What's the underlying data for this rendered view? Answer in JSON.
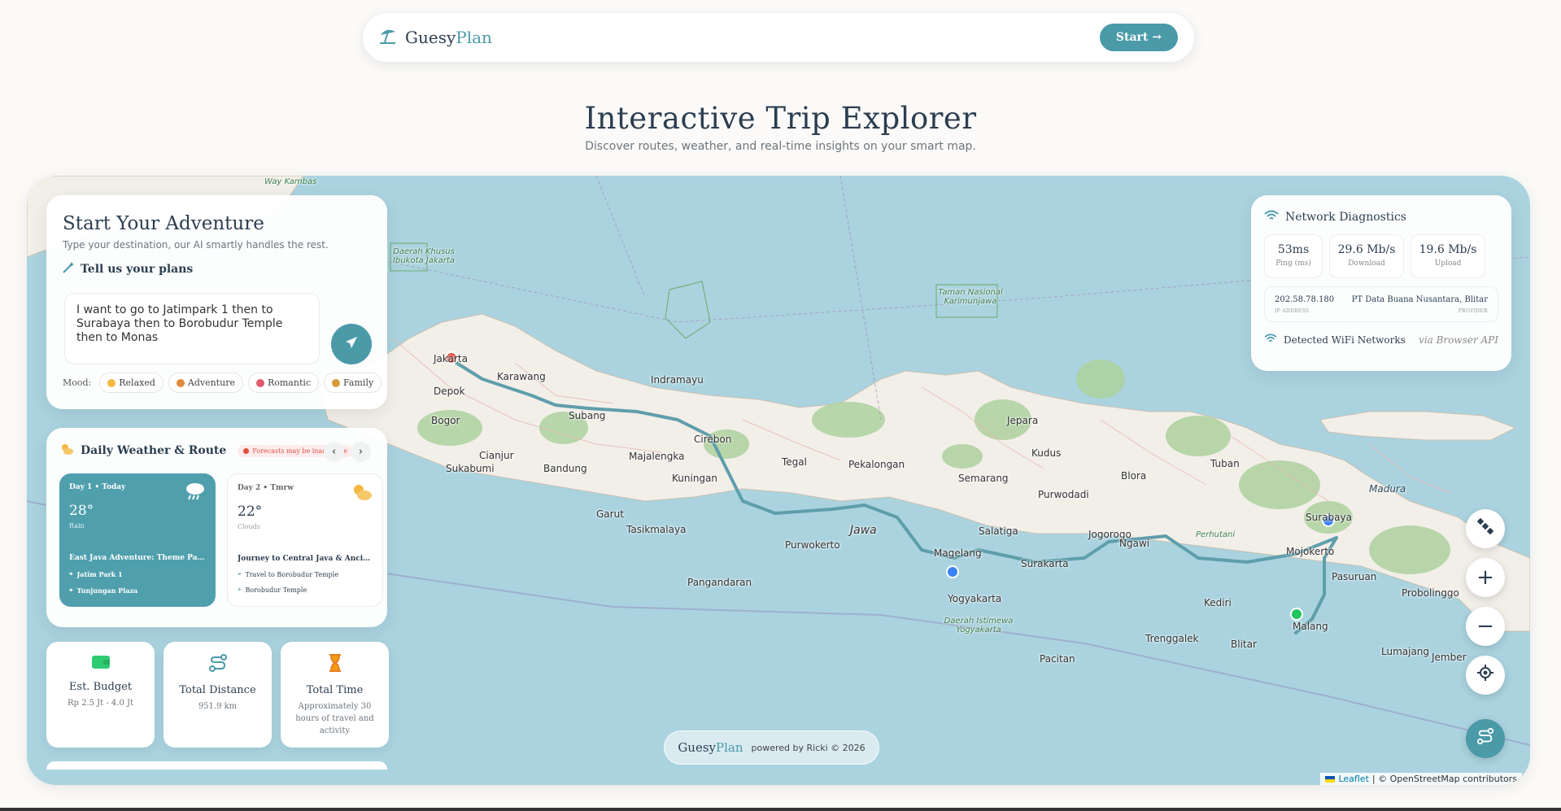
{
  "nav": {
    "brand_prefix": "Guesy",
    "brand_suffix": "Plan",
    "start_label": "Start →"
  },
  "hero": {
    "title": "Interactive Trip Explorer",
    "subtitle": "Discover routes, weather, and real-time insights on your smart map."
  },
  "adventure": {
    "title": "Start Your Adventure",
    "subtitle": "Type your destination, our AI smartly handles the rest.",
    "plans_label": "Tell us your plans",
    "plans_text": "I want to go to Jatimpark 1 then to Surabaya then to Borobudur Temple then to Monas",
    "mood_label": "Mood:",
    "moods": [
      "Relaxed",
      "Adventure",
      "Romantic",
      "Family"
    ]
  },
  "weather": {
    "title": "Daily Weather & Route",
    "warning": "Forecasts may be inaccurate",
    "prev": "‹",
    "next": "›",
    "days": [
      {
        "label": "Day 1 • Today",
        "temp": "28°",
        "condition": "Rain",
        "trip": "East Java Adventure: Theme Park ...",
        "stops": [
          "Jatim Park 1",
          "Tunjungan Plaza"
        ]
      },
      {
        "label": "Day 2 • Tmrw",
        "temp": "22°",
        "condition": "Clouds",
        "trip": "Journey to Central Java & Ancient ...",
        "stops": [
          "Travel to Borobudur Temple",
          "Borobudur Temple"
        ]
      }
    ]
  },
  "stats": {
    "budget": {
      "title": "Est. Budget",
      "value": "Rp 2.5 Jt - 4.0 Jt"
    },
    "distance": {
      "title": "Total Distance",
      "value": "951.9 km"
    },
    "time": {
      "title": "Total Time",
      "value": "Approximately 30 hours of travel and activity"
    }
  },
  "network": {
    "title": "Network Diagnostics",
    "ping": {
      "value": "53ms",
      "caption": "Ping (ms)"
    },
    "download": {
      "value": "29.6 Mb/s",
      "caption": "Download"
    },
    "upload": {
      "value": "19.6 Mb/s",
      "caption": "Upload"
    },
    "ip": {
      "value": "202.58.78.180",
      "caption": "IP ADDRESS"
    },
    "provider": {
      "value": "PT Data Buana Nusantara, Blitar",
      "caption": "PROVIDER"
    },
    "wifi_label": "Detected WiFi Networks",
    "wifi_via": "via Browser API"
  },
  "map": {
    "labels": {
      "jakarta": "Jakarta",
      "depok": "Depok",
      "bogor": "Bogor",
      "karawang": "Karawang",
      "subang": "Subang",
      "indramayu": "Indramayu",
      "cirebon": "Cirebon",
      "majalengka": "Majalengka",
      "kuningan": "Kuningan",
      "cianjur": "Cianjur",
      "bandung": "Bandung",
      "sukabumi": "Sukabumi",
      "garut": "Garut",
      "tasikmalaya": "Tasikmalaya",
      "pangandaran": "Pangandaran",
      "purwokerto": "Purwokerto",
      "jawa": "Jawa",
      "tegal": "Tegal",
      "pekalongan": "Pekalongan",
      "semarang": "Semarang",
      "jepara": "Jepara",
      "kudus": "Kudus",
      "purwodadi": "Purwodadi",
      "blora": "Blora",
      "tuban": "Tuban",
      "madura": "Madura",
      "surabaya": "Surabaya",
      "magelang": "Magelang",
      "salatiga": "Salatiga",
      "surakarta": "Surakarta",
      "yogyakarta": "Yogyakarta",
      "diy": "Daerah Istimewa Yogyakarta",
      "jogorogo": "Jogorogo",
      "ngawi": "Ngawi",
      "perhutani": "Perhutani",
      "mojokerto": "Mojokerto",
      "pasuruan": "Pasuruan",
      "probolinggo": "Probolinggo",
      "malang": "Malang",
      "kediri": "Kediri",
      "blitar": "Blitar",
      "trenggalek": "Trenggalek",
      "pacitan": "Pacitan",
      "lumajang": "Lumajang",
      "jember": "Jember",
      "wonosobo": "Way Kambas",
      "dki": "Daerah Khusus Ibukota Jakarta",
      "karimunjawa": "Taman Nasional Karimunjawa"
    }
  },
  "footer": {
    "brand_prefix": "Guesy",
    "brand_suffix": "Plan",
    "powered": "powered by Ricki © 2026"
  },
  "attribution": {
    "leaflet": "Leaflet",
    "osm": "| © OpenStreetMap contributors"
  },
  "colors": {
    "accent": "#4a9aa8",
    "route": "#5f9eab",
    "sea": "#aad3df",
    "land": "#f2efe9",
    "forest": "#add19e"
  },
  "icons": {
    "brand": "umbrella-beach-icon",
    "send": "paper-plane-icon",
    "wand": "magic-wand-icon",
    "weather": "sun-cloud-icon",
    "rain": "cloud-rain-icon",
    "wifi": "wifi-icon",
    "wallet": "wallet-icon",
    "route": "route-icon",
    "hourglass": "hourglass-icon",
    "satellite": "satellite-icon",
    "zoom_in": "plus-icon",
    "zoom_out": "minus-icon",
    "locate": "crosshair-icon"
  }
}
